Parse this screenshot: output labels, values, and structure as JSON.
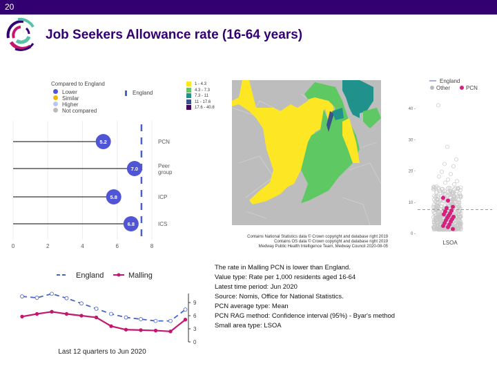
{
  "header": {
    "slide_number": "20",
    "title": "Job Seekers Allowance rate (16-64 years)"
  },
  "colors": {
    "header": "#330072",
    "lower": "#5055d6",
    "similar": "#f2b800",
    "higher": "#b8c8f0",
    "not_compared": "#bbbbbb",
    "england": "#4863c7",
    "malling": "#c4166f",
    "pcn_point": "#d6207e",
    "map_bg": "#bdbdbd"
  },
  "chart_data": [
    {
      "type": "lollipop",
      "title": "Compared to England",
      "legend": {
        "items": [
          {
            "label": "Lower",
            "color": "#5055d6"
          },
          {
            "label": "Similar",
            "color": "#f2b800"
          },
          {
            "label": "Higher",
            "color": "#b8c8f0"
          },
          {
            "label": "Not compared",
            "color": "#bbbbbb"
          }
        ],
        "england_label": "England"
      },
      "categories": [
        "PCN",
        "Peer group",
        "ICP",
        "ICS"
      ],
      "category_lines": [
        [
          "PCN"
        ],
        [
          "Peer",
          "group"
        ],
        [
          "ICP"
        ],
        [
          "ICS"
        ]
      ],
      "values": [
        5.2,
        7.0,
        5.8,
        6.8
      ],
      "value_labels": [
        "5.2",
        "7.0",
        "5.8",
        "6.8"
      ],
      "england_value": 7.4,
      "xlim": [
        0,
        8
      ],
      "xticks": [
        "0",
        "2",
        "4",
        "6",
        "8"
      ]
    },
    {
      "type": "map",
      "legend": [
        "1 - 4.3",
        "4.3 - 7.3",
        "7.3 - 11",
        "11 - 17.6",
        "17.6 - 40.8"
      ],
      "legend_colors": [
        "#fde725",
        "#5ec962",
        "#21918c",
        "#3b528b",
        "#440154"
      ],
      "credits": [
        "Contains National Statistics data © Crown copyright and database right 2019",
        "Contains OS data © Crown copyright and database right 2019",
        "Medway Public Health Intelligence Team, Medway Council 2020-08-05"
      ]
    },
    {
      "type": "scatter",
      "legend": {
        "england": "England",
        "other": "Other",
        "pcn": "PCN"
      },
      "xlabel": "LSOA",
      "ylim": [
        0,
        42
      ],
      "yticks": [
        "0",
        "10",
        "20",
        "30",
        "40"
      ],
      "england_value": 7.4,
      "other_outliers": [
        40.8,
        27.5,
        23.5,
        22,
        21.3,
        19.5,
        18.8,
        18,
        17,
        16.5,
        16,
        15.5
      ],
      "pcn_values": [
        11.2,
        10.3,
        8.3,
        7.9,
        7.1,
        6.8,
        6.2,
        5.9,
        5.5,
        5.1,
        4.8,
        4.4,
        4.0,
        3.6,
        3.1,
        2.6,
        2.2,
        1.8,
        1.2
      ]
    },
    {
      "type": "line",
      "title": "Last 12 quarters to Jun 2020",
      "series": [
        {
          "name": "England",
          "values": [
            10.4,
            10.1,
            11.0,
            10.0,
            8.8,
            7.6,
            6.4,
            5.6,
            5.2,
            4.8,
            4.8,
            7.4
          ]
        },
        {
          "name": "Malling",
          "values": [
            5.8,
            6.4,
            6.9,
            6.4,
            6.0,
            5.6,
            3.6,
            2.8,
            2.7,
            2.6,
            2.4,
            5.1
          ]
        }
      ],
      "ylim": [
        0,
        11.5
      ],
      "yticks": [
        "0",
        "3",
        "6",
        "9"
      ]
    }
  ],
  "info": [
    "The rate in Malling PCN is lower than England.",
    "Value type: Rate per 1,000 residents aged 16-64",
    "Latest time period: Jun 2020",
    "Source: Nomis, Office for National Statistics.",
    "PCN average type: Mean",
    "PCN RAG method: Confidence interval (95%) - Byar's method",
    "Small area type: LSOA"
  ]
}
